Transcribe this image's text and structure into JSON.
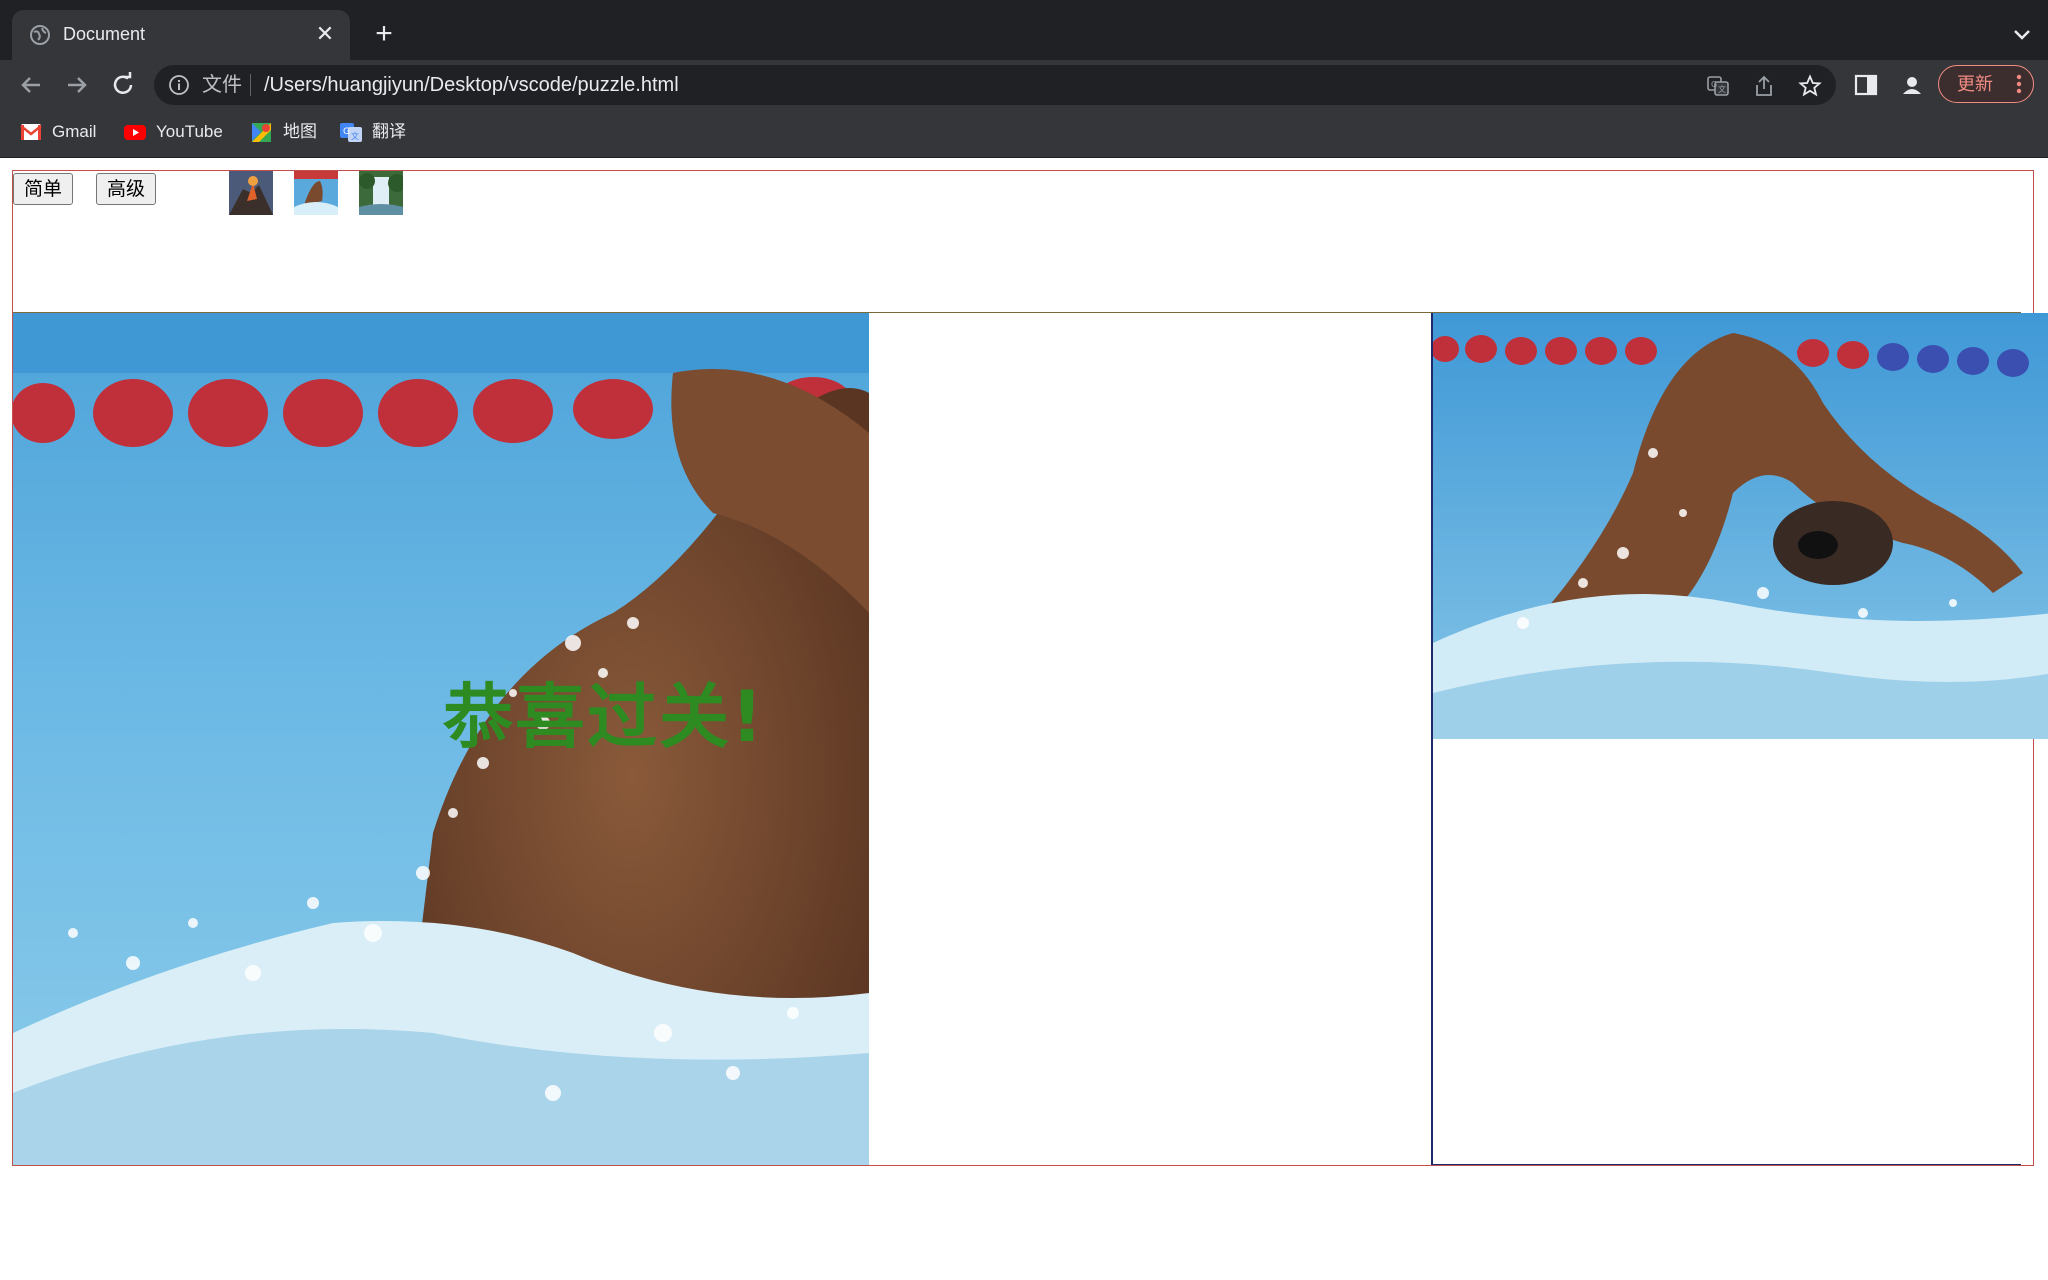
{
  "browser": {
    "tab_title": "Document",
    "url_scheme": "文件",
    "url": "/Users/huangjiyun/Desktop/vscode/puzzle.html",
    "update_label": "更新",
    "bookmarks": [
      {
        "label": "Gmail",
        "icon": "gmail-icon"
      },
      {
        "label": "YouTube",
        "icon": "youtube-icon"
      },
      {
        "label": "地图",
        "icon": "maps-icon"
      },
      {
        "label": "翻译",
        "icon": "translate-icon"
      }
    ]
  },
  "game": {
    "buttons": {
      "easy": "简单",
      "hard": "高级"
    },
    "thumbnails": [
      "volcano-thumbnail",
      "swimmer-thumbnail",
      "waterfall-thumbnail"
    ],
    "win_message": "恭喜过关!"
  },
  "colors": {
    "win_text": "#2e8b22",
    "container_border": "#c0504d",
    "ref_border": "#1f2a6b",
    "update_accent": "#f28b82"
  }
}
